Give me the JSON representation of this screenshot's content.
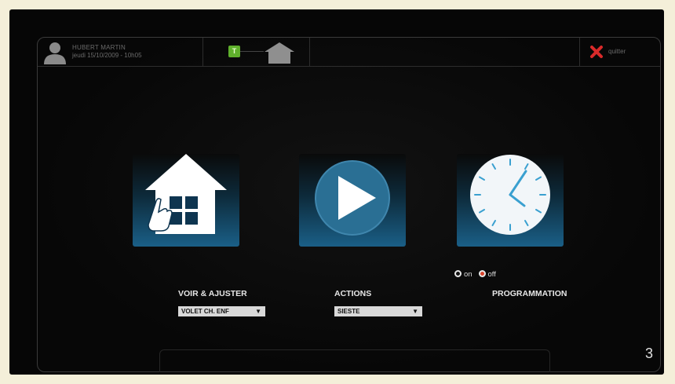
{
  "header": {
    "user_name": "HUBERT MARTIN",
    "user_datetime": "jeudi 15/10/2009 - 10h05",
    "status_badge": "T",
    "quit_label": "quitter"
  },
  "tiles": [
    {
      "label": "VOIR & AJUSTER",
      "select_value": "VOLET CH. ENF",
      "icon": "house-hand-icon"
    },
    {
      "label": "ACTIONS",
      "select_value": "SIESTE",
      "icon": "play-icon"
    },
    {
      "label": "PROGRAMMATION",
      "icon": "clock-icon",
      "radio_options": [
        "on",
        "off"
      ],
      "radio_selected": "off"
    }
  ],
  "dropdown_arrow": "▼",
  "page_number": "3",
  "colors": {
    "accent_blue": "#1a5f87",
    "status_green": "#5fb02c",
    "quit_red": "#d92a2a",
    "radio_off": "#d9432b"
  }
}
